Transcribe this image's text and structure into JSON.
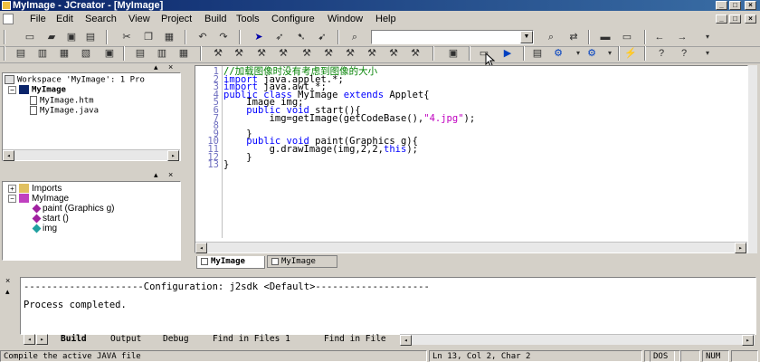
{
  "window": {
    "title": "MyImage - JCreator - [MyImage]"
  },
  "menu": [
    "File",
    "Edit",
    "Search",
    "View",
    "Project",
    "Build",
    "Tools",
    "Configure",
    "Window",
    "Help"
  ],
  "workspace": {
    "header": "Workspace 'MyImage': 1 Pro",
    "project": "MyImage",
    "files": [
      "MyImage.htm",
      "MyImage.java"
    ]
  },
  "classview": {
    "items": [
      "Imports",
      "MyImage",
      "paint (Graphics g)",
      "start ()",
      "img"
    ]
  },
  "editor": {
    "line_numbers": [
      "1",
      "2",
      "3",
      "4",
      "5",
      "6",
      "7",
      "8",
      "9",
      "10",
      "11",
      "12",
      "13"
    ],
    "tabs": [
      "MyImage",
      "MyImage"
    ]
  },
  "output": {
    "config_line": "---------------------Configuration: j2sdk <Default>--------------------",
    "result": "Process completed.",
    "tabs": [
      "Build",
      "Output",
      "Debug",
      "Find in Files 1",
      "Find in File"
    ]
  },
  "status": {
    "message": "Compile the active JAVA file",
    "position": "Ln 13, Col 2, Char 2",
    "mode": "DOS",
    "num": "NUM"
  },
  "colors": {
    "keyword": "#0000ff",
    "string": "#c000c0",
    "comment": "#008000",
    "titlebar": "#0a246a"
  }
}
